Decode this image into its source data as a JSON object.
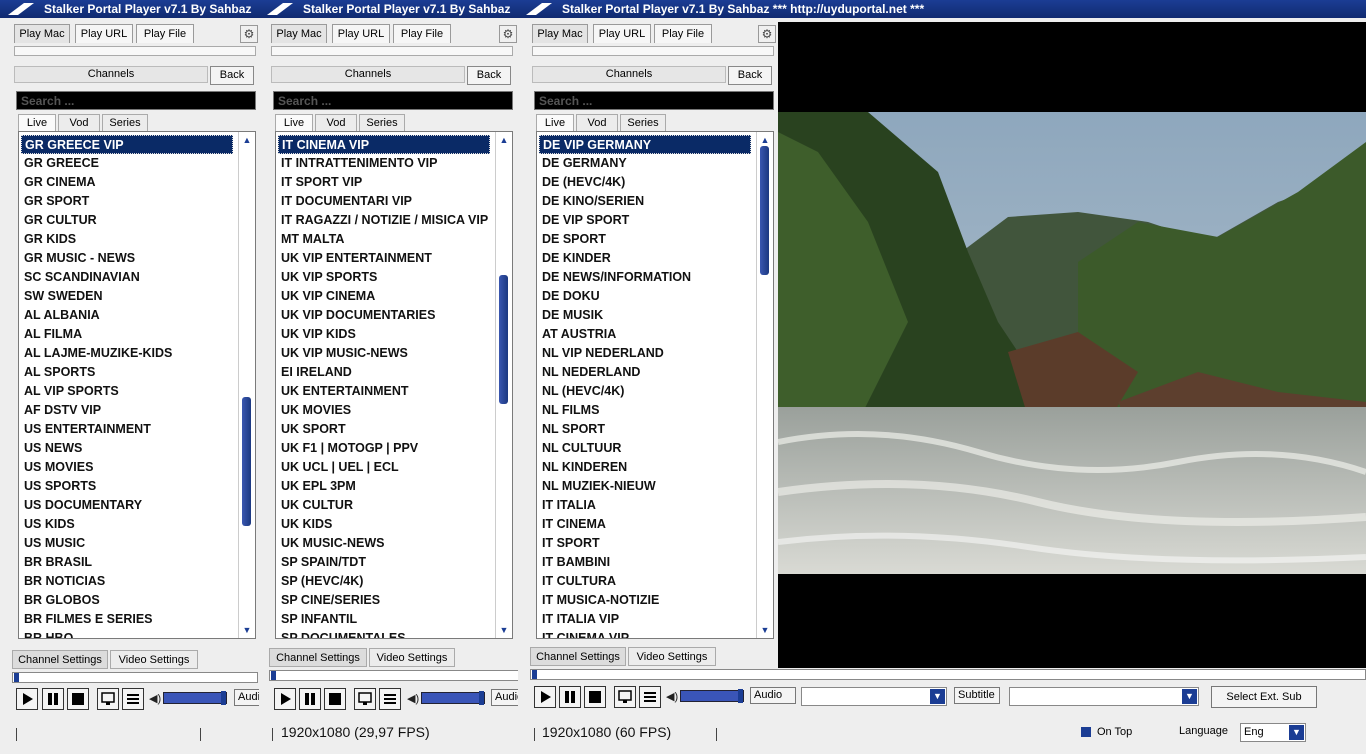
{
  "windows": [
    {
      "title": "Stalker Portal Player v7.1 By Sahbaz",
      "tabs": [
        "Play Mac",
        "Play URL",
        "Play File"
      ],
      "channels_label": "Channels",
      "back_label": "Back",
      "search_placeholder": "Search ...",
      "subtabs": [
        "Live",
        "Vod",
        "Series"
      ],
      "channels": [
        "GR GREECE VIP",
        "GR GREECE",
        "GR CINEMA",
        "GR SPORT",
        "GR CULTUR",
        "GR KIDS",
        "GR MUSIC - NEWS",
        "SC SCANDINAVIAN",
        "SW SWEDEN",
        "AL ALBANIA",
        "AL FILMA",
        "AL LAJME-MUZIKE-KIDS",
        "AL SPORTS",
        "AL VIP SPORTS",
        "AF DSTV VIP",
        "US ENTERTAINMENT",
        "US NEWS",
        "US MOVIES",
        "US SPORTS",
        "US DOCUMENTARY",
        "US KIDS",
        "US MUSIC",
        "BR BRASIL",
        "BR NOTICIAS",
        "BR  GLOBOS",
        "BR FILMES E SERIES",
        "BR HBO"
      ],
      "settings_tabs": [
        "Channel Settings",
        "Video Settings"
      ],
      "audio_label": "Audio",
      "status_text": ""
    },
    {
      "title": "Stalker Portal Player v7.1 By Sahbaz",
      "tabs": [
        "Play Mac",
        "Play URL",
        "Play File"
      ],
      "channels_label": "Channels",
      "back_label": "Back",
      "search_placeholder": "Search ...",
      "subtabs": [
        "Live",
        "Vod",
        "Series"
      ],
      "channels": [
        "IT CINEMA VIP",
        "IT INTRATTENIMENTO VIP",
        "IT SPORT VIP",
        "IT DOCUMENTARI VIP",
        "IT RAGAZZI / NOTIZIE / MISICA VIP",
        "MT MALTA",
        "UK VIP ENTERTAINMENT",
        "UK VIP SPORTS",
        "UK VIP CINEMA",
        "UK VIP DOCUMENTARIES",
        "UK VIP KIDS",
        "UK VIP MUSIC-NEWS",
        "EI IRELAND",
        "UK ENTERTAINMENT",
        "UK MOVIES",
        "UK SPORT",
        "UK F1 | MOTOGP | PPV",
        "UK UCL | UEL | ECL",
        "UK EPL 3PM",
        "UK CULTUR",
        "UK KIDS",
        "UK MUSIC-NEWS",
        "SP SPAIN/TDT",
        "SP (HEVC/4K)",
        "SP CINE/SERIES",
        "SP INFANTIL",
        "SP DOCUMENTALES"
      ],
      "settings_tabs": [
        "Channel Settings",
        "Video Settings"
      ],
      "audio_label": "Audio",
      "status_text": "1920x1080   (29,97 FPS)"
    },
    {
      "title": "Stalker Portal Player v7.1 By Sahbaz   *** http://uyduportal.net ***",
      "tabs": [
        "Play Mac",
        "Play URL",
        "Play File"
      ],
      "channels_label": "Channels",
      "back_label": "Back",
      "search_placeholder": "Search ...",
      "subtabs": [
        "Live",
        "Vod",
        "Series"
      ],
      "channels": [
        "DE VIP GERMANY",
        "DE GERMANY",
        "DE (HEVC/4K)",
        "DE KINO/SERIEN",
        "DE VIP SPORT",
        "DE SPORT",
        "DE KINDER",
        "DE NEWS/INFORMATION",
        "DE DOKU",
        "DE MUSIK",
        "AT AUSTRIA",
        "NL VIP NEDERLAND",
        "NL NEDERLAND",
        "NL (HEVC/4K)",
        "NL FILMS",
        "NL SPORT",
        "NL CULTUUR",
        "NL KINDEREN",
        "NL MUZIEK-NIEUW",
        "IT ITALIA",
        "IT CINEMA",
        "IT SPORT",
        "IT BAMBINI",
        "IT CULTURA",
        "IT MUSICA-NOTIZIE",
        "IT ITALIA VIP",
        "IT CINEMA VIP"
      ],
      "settings_tabs": [
        "Channel Settings",
        "Video Settings"
      ],
      "audio_label": "Audio",
      "subtitle_label": "Subtitle",
      "select_ext_sub_label": "Select Ext. Sub",
      "status_text": "1920x1080   (60 FPS)",
      "on_top_label": "On Top",
      "language_label": "Language",
      "language_value": "Eng"
    }
  ],
  "colors": {
    "titlebar": "#15358a",
    "selection": "#0a2a66",
    "accent": "#1b3d94"
  },
  "scrollbars": [
    {
      "position": 0.72,
      "size": 0.27
    },
    {
      "position": 0.37,
      "size": 0.27
    },
    {
      "position": 0.0,
      "size": 0.27
    }
  ],
  "icons": [
    "play-icon",
    "pause-icon",
    "stop-icon",
    "monitor-icon",
    "playlist-icon",
    "speaker-icon",
    "gear-icon",
    "chevron-down-icon"
  ]
}
